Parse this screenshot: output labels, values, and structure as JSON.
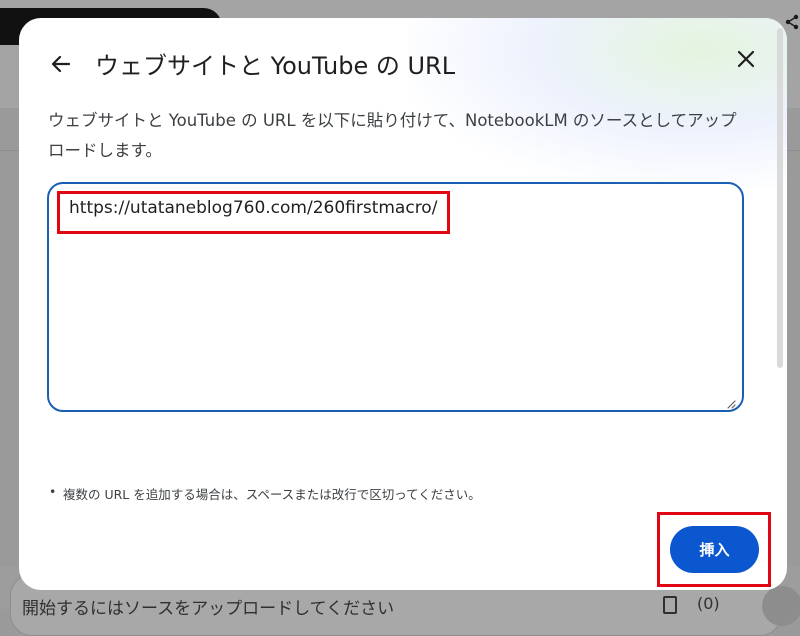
{
  "background": {
    "chat_placeholder": "開始するにはソースをアップロードしてください",
    "source_count": "(0)"
  },
  "dialog": {
    "title": "ウェブサイトと YouTube の URL",
    "description": "ウェブサイトと YouTube の URL を以下に貼り付けて、NotebookLM のソースとしてアップロードします。",
    "url_value": "https://utataneblog760.com/260firstmacro/",
    "hint": "複数の URL を追加する場合は、スペースまたは改行で区切ってください。",
    "insert_label": "挿入"
  },
  "colors": {
    "accent": "#0b57d0",
    "highlight": "#e10613",
    "border": "#1a5fb4"
  },
  "icons": [
    "back-arrow-icon",
    "close-icon",
    "share-icon",
    "document-icon",
    "resize-handle-icon"
  ]
}
